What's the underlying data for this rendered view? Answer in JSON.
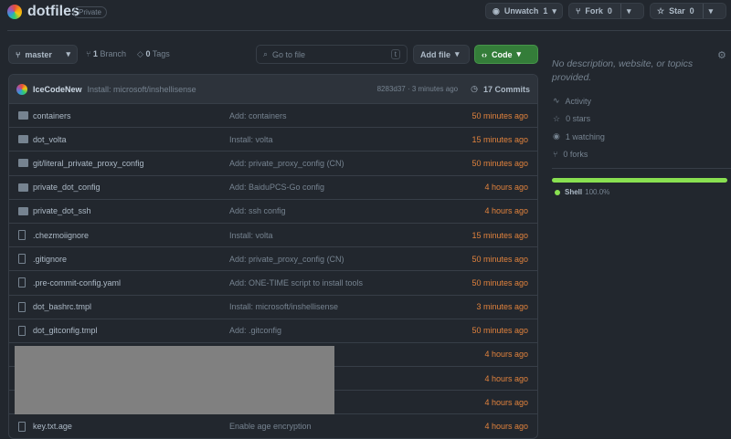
{
  "repo": {
    "name": "dotfiles",
    "visibility": "Private"
  },
  "actions": {
    "watch_label": "Unwatch",
    "watch_count": "1",
    "fork_label": "Fork",
    "fork_count": "0",
    "star_label": "Star",
    "star_count": "0"
  },
  "toolbar": {
    "branch": "master",
    "branches_count": "1",
    "branches_label": "Branch",
    "tags_count": "0",
    "tags_label": "Tags",
    "search_placeholder": "Go to file",
    "search_shortcut": "t",
    "add_file": "Add file",
    "code": "Code"
  },
  "commit": {
    "author": "IceCodeNew",
    "message": "Install: microsoft/inshellisense",
    "meta": "8283d37 · 3 minutes ago",
    "commits": "17 Commits"
  },
  "files": [
    {
      "type": "folder",
      "name": "containers",
      "message": "Add: containers",
      "time": "50 minutes ago"
    },
    {
      "type": "folder",
      "name": "dot_volta",
      "message": "Install: volta",
      "time": "15 minutes ago"
    },
    {
      "type": "folder",
      "name": "git/literal_private_proxy_config",
      "message": "Add: private_proxy_config (CN)",
      "time": "50 minutes ago"
    },
    {
      "type": "folder",
      "name": "private_dot_config",
      "message": "Add: BaiduPCS-Go config",
      "time": "4 hours ago"
    },
    {
      "type": "folder",
      "name": "private_dot_ssh",
      "message": "Add: ssh config",
      "time": "4 hours ago"
    },
    {
      "type": "file",
      "name": ".chezmoiignore",
      "message": "Install: volta",
      "time": "15 minutes ago"
    },
    {
      "type": "file",
      "name": ".gitignore",
      "message": "Add: private_proxy_config (CN)",
      "time": "50 minutes ago"
    },
    {
      "type": "file",
      "name": ".pre-commit-config.yaml",
      "message": "Add: ONE-TIME script to install tools",
      "time": "50 minutes ago"
    },
    {
      "type": "file",
      "name": "dot_bashrc.tmpl",
      "message": "Install: microsoft/inshellisense",
      "time": "3 minutes ago"
    },
    {
      "type": "file",
      "name": "dot_gitconfig.tmpl",
      "message": "Add: .gitconfig",
      "time": "50 minutes ago"
    },
    {
      "type": "redacted",
      "name": "",
      "message": "",
      "time": "4 hours ago"
    },
    {
      "type": "redacted",
      "name": "",
      "message": "",
      "time": "4 hours ago"
    },
    {
      "type": "redacted",
      "name": "",
      "message": "",
      "time": "4 hours ago"
    },
    {
      "type": "file",
      "name": "key.txt.age",
      "message": "Enable age encryption",
      "time": "4 hours ago"
    }
  ],
  "about": {
    "description": "No description, website, or topics provided.",
    "activity": "Activity",
    "stars": "0 stars",
    "watching": "1 watching",
    "forks": "0 forks"
  },
  "languages": [
    {
      "name": "Shell",
      "percent": "100.0%",
      "value": 100,
      "color": "#89e051"
    }
  ],
  "colors": {
    "accent_green": "#347d39",
    "time": "#e0823d",
    "bg": "#22272e"
  }
}
